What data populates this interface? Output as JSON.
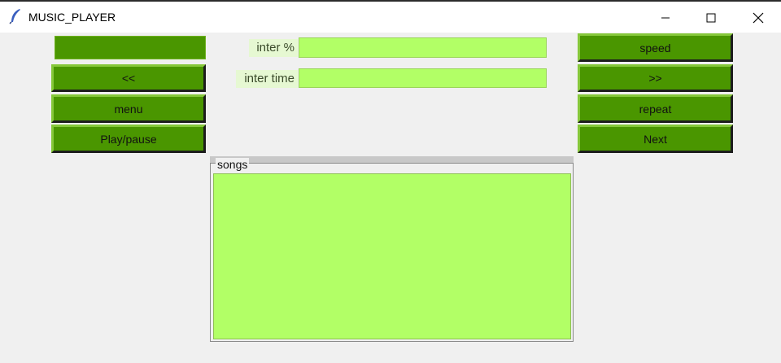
{
  "window": {
    "title": "MUSIC_PLAYER",
    "controls": [
      "minimize",
      "maximize",
      "close"
    ]
  },
  "left_panel": {
    "previous_label": "<<",
    "menu_label": "menu",
    "play_pause_label": "Play/pause"
  },
  "center_panel": {
    "inter_percent_label": "inter %",
    "inter_percent_value": "",
    "inter_time_label": "inter time",
    "inter_time_value": ""
  },
  "right_panel": {
    "speed_label": "speed",
    "forward_label": ">>",
    "repeat_label": "repeat",
    "next_label": "Next"
  },
  "songs": {
    "legend": "songs",
    "items": []
  },
  "colors": {
    "button_bg": "#4a9600",
    "entry_bg": "#b2ff66",
    "label_bg": "#e6f8d2",
    "window_bg": "#f0f0f0"
  }
}
